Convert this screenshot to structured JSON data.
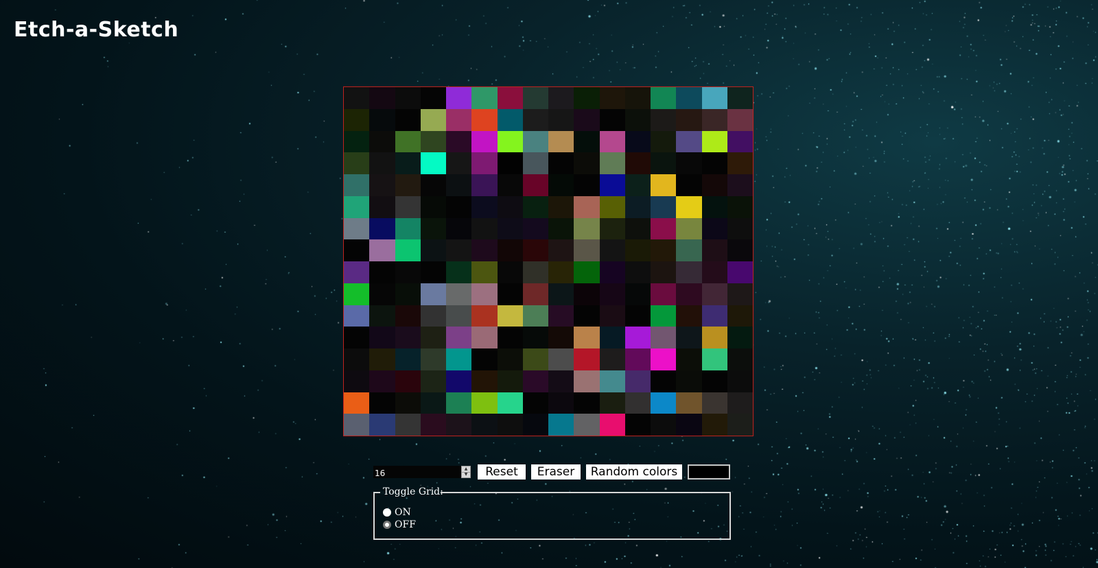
{
  "app": {
    "title": "Etch-a-Sketch"
  },
  "colors": {
    "grid_border": "#c0221e",
    "title": "#ffffff",
    "button_bg": "#ffffff"
  },
  "grid": {
    "size": 16,
    "cells": [
      [
        "#121212",
        "#140812",
        "#0c0c0c",
        "#050505",
        "#8f2bd8",
        "#2f9868",
        "#8a0f3c",
        "#243a32",
        "#1c1a1e",
        "#0a1f06",
        "#1e160a",
        "#16140a",
        "#128654",
        "#0d4a5c",
        "#48a6bc",
        "#0f241e"
      ],
      [
        "#1c2404",
        "#060a0c",
        "#040404",
        "#96aa52",
        "#9a2f66",
        "#de4320",
        "#025a6a",
        "#1c1c1c",
        "#161616",
        "#1a0a1a",
        "#040404",
        "#0c100a",
        "#1c1a18",
        "#261812",
        "#3a2626",
        "#6a3242"
      ],
      [
        "#042210",
        "#0c0c0a",
        "#407226",
        "#2f4520",
        "#2a0a26",
        "#c214c4",
        "#84f41e",
        "#4a8280",
        "#b48c52",
        "#040e0a",
        "#b4488e",
        "#080a1a",
        "#141a0c",
        "#544a86",
        "#aeea18",
        "#420f62"
      ],
      [
        "#283e18",
        "#121212",
        "#081c1a",
        "#04fac4",
        "#161616",
        "#7e1a72",
        "#020202",
        "#48565c",
        "#040404",
        "#0c0c08",
        "#607c56",
        "#200a06",
        "#0a140e",
        "#080808",
        "#040404",
        "#2e1a08"
      ],
      [
        "#307068",
        "#161214",
        "#221a10",
        "#060606",
        "#0c1012",
        "#3a1456",
        "#080808",
        "#680428",
        "#040a06",
        "#040404",
        "#0a0c96",
        "#0c201a",
        "#e2b61e",
        "#040404",
        "#140808",
        "#1c0e1c"
      ],
      [
        "#20a478",
        "#120e12",
        "#343434",
        "#060a06",
        "#040404",
        "#0c0c1e",
        "#0e0c12",
        "#082010",
        "#1c1608",
        "#a86456",
        "#586004",
        "#0c1c24",
        "#183a52",
        "#e4cc16",
        "#04120e",
        "#0a1208"
      ],
      [
        "#6e7c88",
        "#080c60",
        "#148464",
        "#0a140a",
        "#06060a",
        "#121212",
        "#0e0c18",
        "#140a1e",
        "#0a1408",
        "#76844a",
        "#1c220e",
        "#0e100c",
        "#8a0e4a",
        "#78863e",
        "#0c0818",
        "#0e0e0e"
      ],
      [
        "#040404",
        "#9a6e9e",
        "#0cc470",
        "#0c1214",
        "#141414",
        "#1e0a1c",
        "#120606",
        "#2a0608",
        "#1e1414",
        "#5a5648",
        "#141414",
        "#1a1a06",
        "#221808",
        "#386650",
        "#1e0e16",
        "#0a080c"
      ],
      [
        "#5a2a84",
        "#040404",
        "#080808",
        "#040404",
        "#06301a",
        "#4c5610",
        "#080808",
        "#303028",
        "#282406",
        "#04640a",
        "#160422",
        "#0e0e0e",
        "#1c1410",
        "#362a36",
        "#240c1a",
        "#48086e"
      ],
      [
        "#14be2a",
        "#060606",
        "#080e08",
        "#6a7aa0",
        "#686a6a",
        "#9c7080",
        "#040404",
        "#6e2828",
        "#0c1618",
        "#0c0408",
        "#160616",
        "#060808",
        "#6a0c3e",
        "#2e0a20",
        "#422636",
        "#1e1818"
      ],
      [
        "#5a6aa8",
        "#0c140e",
        "#1a0808",
        "#323232",
        "#484c4c",
        "#aa3220",
        "#c4b83e",
        "#4c7e56",
        "#260c24",
        "#040404",
        "#1a0c14",
        "#040404",
        "#04983a",
        "#221008",
        "#3e2c72",
        "#1e1808"
      ],
      [
        "#040404",
        "#120818",
        "#1a0c1c",
        "#1e2014",
        "#7c4088",
        "#9a6a76",
        "#040404",
        "#060a08",
        "#140a06",
        "#ba824a",
        "#061a24",
        "#a61ad8",
        "#725670",
        "#0e161a",
        "#ba9020",
        "#041a10"
      ],
      [
        "#0c0c0c",
        "#201c08",
        "#06222a",
        "#2e3a2a",
        "#02968e",
        "#040404",
        "#0c0e08",
        "#3c4a18",
        "#4c4c4c",
        "#b41628",
        "#1e1c1c",
        "#620a5a",
        "#ec10c8",
        "#0c0e08",
        "#32c47c",
        "#0c0e0c"
      ],
      [
        "#0e0a10",
        "#1e081a",
        "#2a040c",
        "#1c2416",
        "#12086a",
        "#221406",
        "#141a0c",
        "#2a0a28",
        "#140c16",
        "#9a7272",
        "#448a8e",
        "#462a6a",
        "#040404",
        "#0a0c08",
        "#040404",
        "#0c0c0c"
      ],
      [
        "#ea5e16",
        "#040404",
        "#0c0c08",
        "#0a1816",
        "#1c8054",
        "#7ec010",
        "#26d48c",
        "#040404",
        "#0c080e",
        "#040404",
        "#1a1e10",
        "#323030",
        "#0c88c8",
        "#70542c",
        "#3a3430",
        "#1e1c1c"
      ],
      [
        "#5a6070",
        "#2a3a74",
        "#343434",
        "#2a0c1e",
        "#1c121a",
        "#0c1014",
        "#0e0e0e",
        "#06080e",
        "#06788e",
        "#626264",
        "#e80e6e",
        "#040404",
        "#0c0c0c",
        "#0a0612",
        "#221a08",
        "#1c1e1a"
      ]
    ]
  },
  "controls": {
    "grid_size_value": "16",
    "reset_label": "Reset",
    "eraser_label": "Eraser",
    "random_label": "Random colors",
    "color_value": "#000000"
  },
  "toggle": {
    "legend": "Toggle Grid:",
    "on_label": "ON",
    "off_label": "OFF"
  }
}
